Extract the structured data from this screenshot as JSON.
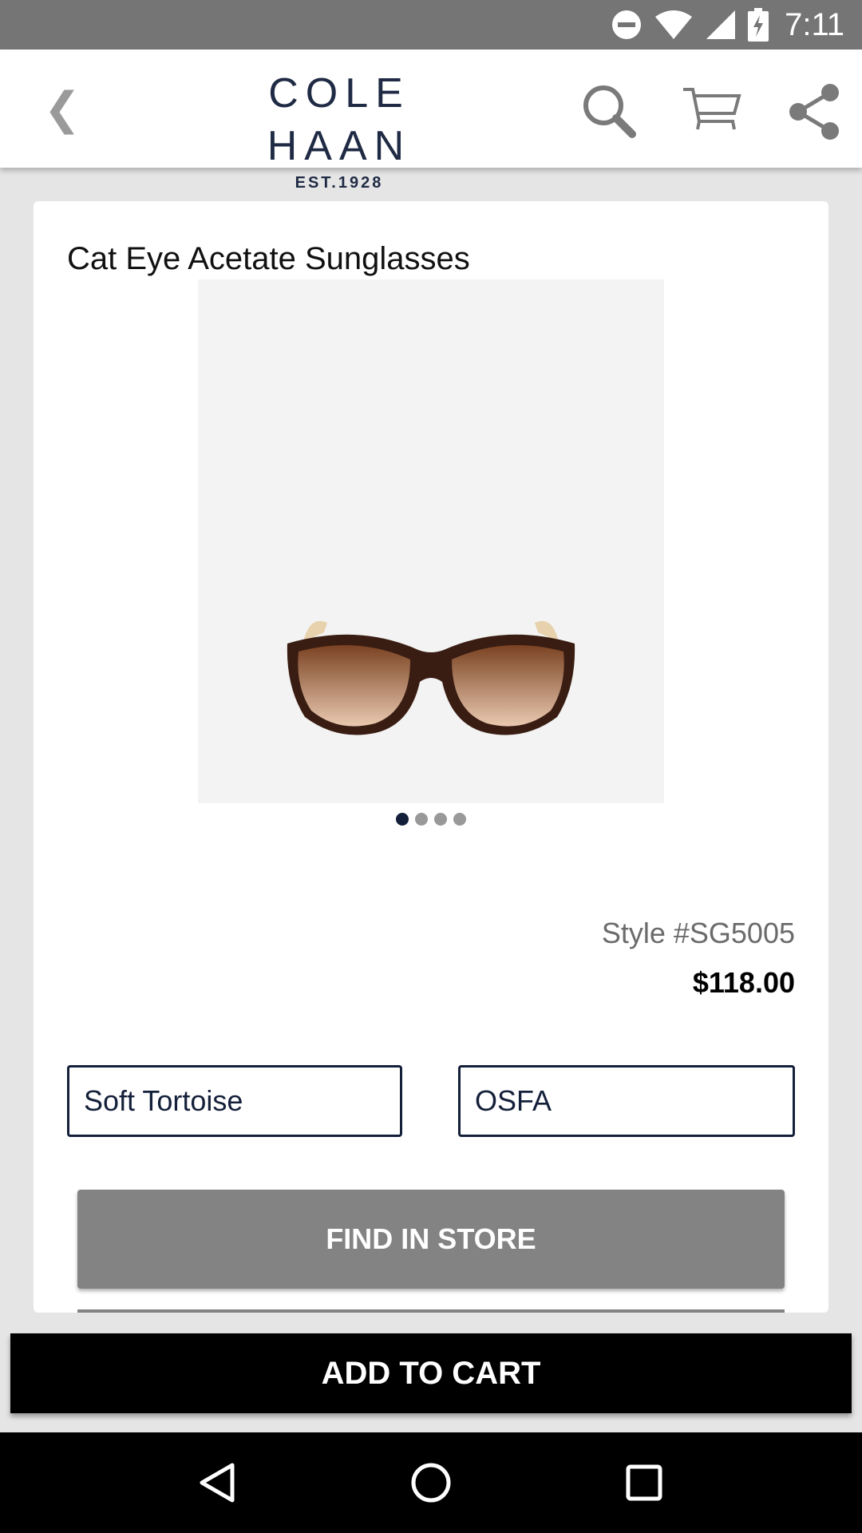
{
  "status_bar": {
    "time": "7:11",
    "icons": [
      "do-not-disturb-icon",
      "wifi-icon",
      "signal-icon",
      "battery-charging-icon"
    ]
  },
  "header": {
    "back_icon": "chevron-left-icon",
    "brand_name": "COLE HAAN",
    "brand_sub": "EST.1928",
    "actions": [
      "search-icon",
      "cart-icon",
      "share-icon"
    ]
  },
  "product": {
    "title": "Cat Eye Acetate Sunglasses",
    "image_count": 4,
    "active_image": 1,
    "style_number": "Style #SG5005",
    "price": "$118.00",
    "color": "Soft Tortoise",
    "size": "OSFA"
  },
  "actions": {
    "find_in_store": "FIND IN STORE",
    "add_to_cart": "ADD TO CART"
  },
  "nav_bar": [
    "back-triangle-icon",
    "home-circle-icon",
    "recents-square-icon"
  ],
  "colors": {
    "brand_navy": "#1f2a44",
    "button_gray": "#838383",
    "cart_black": "#000000"
  }
}
